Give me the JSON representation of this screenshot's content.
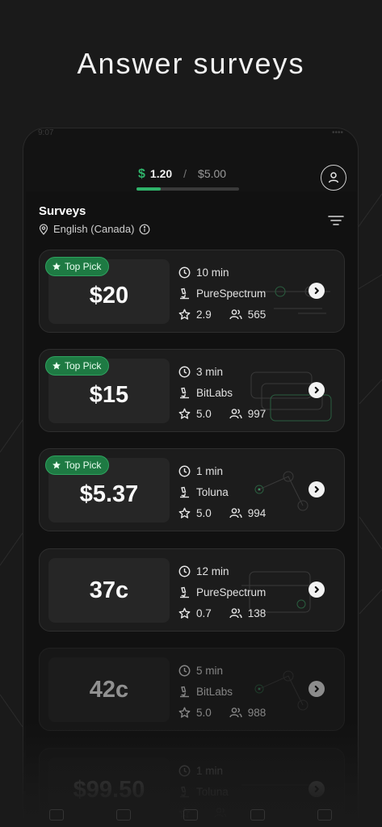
{
  "headline": "Answer surveys",
  "status_bar": {
    "time": "9:07",
    "signal": "••••"
  },
  "balance": {
    "symbol": "$",
    "current": "1.20",
    "separator": "/",
    "goal": "$5.00",
    "progress": 0.24
  },
  "surveys": {
    "title": "Surveys",
    "locale": "English (Canada)",
    "items": [
      {
        "top_pick": true,
        "badge": "Top Pick",
        "amount": "$20",
        "duration": "10 min",
        "provider": "PureSpectrum",
        "rating": "2.9",
        "respondents": "565"
      },
      {
        "top_pick": true,
        "badge": "Top Pick",
        "amount": "$15",
        "duration": "3 min",
        "provider": "BitLabs",
        "rating": "5.0",
        "respondents": "997"
      },
      {
        "top_pick": true,
        "badge": "Top Pick",
        "amount": "$5.37",
        "duration": "1 min",
        "provider": "Toluna",
        "rating": "5.0",
        "respondents": "994"
      },
      {
        "top_pick": false,
        "badge": "",
        "amount": "37c",
        "duration": "12 min",
        "provider": "PureSpectrum",
        "rating": "0.7",
        "respondents": "138"
      },
      {
        "top_pick": false,
        "badge": "",
        "amount": "42c",
        "duration": "5 min",
        "provider": "BitLabs",
        "rating": "5.0",
        "respondents": "988"
      },
      {
        "top_pick": false,
        "badge": "",
        "amount": "$99.50",
        "duration": "1 min",
        "provider": "Toluna",
        "rating": "",
        "respondents": ""
      }
    ]
  },
  "colors": {
    "accent": "#2fb36a",
    "badge_bg": "#1e7a43",
    "card_bg": "#1c1c1c",
    "page_bg": "#1a1a1a"
  },
  "icons": [
    "clock-icon",
    "microscope-icon",
    "star-icon",
    "users-icon",
    "chevron-right-icon",
    "user-icon",
    "filter-icon",
    "location-pin-icon",
    "info-icon"
  ]
}
